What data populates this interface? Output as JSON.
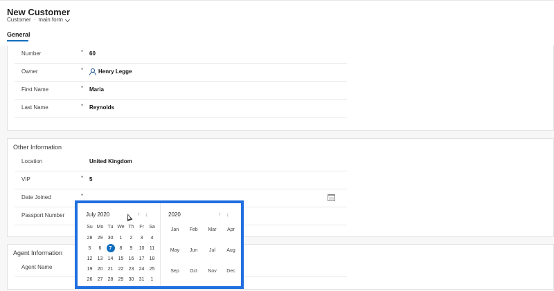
{
  "header": {
    "title": "New Customer",
    "entity": "Customer",
    "separator": "·",
    "form": "main form",
    "tab": "General"
  },
  "general": {
    "rows": [
      {
        "label": "Number",
        "required": "*",
        "value": "60"
      },
      {
        "label": "Owner",
        "required": "*",
        "value": "Henry Legge"
      },
      {
        "label": "First Name",
        "required": "*",
        "value": "Maria"
      },
      {
        "label": "Last Name",
        "required": "*",
        "value": "Reynolds"
      }
    ]
  },
  "other": {
    "title": "Other Information",
    "rows": [
      {
        "label": "Location",
        "required": "",
        "value": "United Kingdom"
      },
      {
        "label": "VIP",
        "required": "*",
        "value": "5"
      },
      {
        "label": "Date Joined",
        "required": "*",
        "value": ""
      },
      {
        "label": "Passport Number",
        "required": "",
        "value": ""
      }
    ]
  },
  "agent": {
    "title": "Agent Information",
    "rows": [
      {
        "label": "Agent Name",
        "required": "",
        "value": ""
      }
    ]
  },
  "calendar": {
    "month_label": "July 2020",
    "year_label": "2020",
    "up_arrow": "↑",
    "down_arrow": "↓",
    "weekdays": [
      "Su",
      "Mo",
      "Tu",
      "We",
      "Th",
      "Fr",
      "Sa"
    ],
    "days": [
      "28",
      "29",
      "30",
      "1",
      "2",
      "3",
      "4",
      "5",
      "6",
      "7",
      "8",
      "9",
      "10",
      "11",
      "12",
      "13",
      "14",
      "15",
      "16",
      "17",
      "18",
      "19",
      "20",
      "21",
      "22",
      "23",
      "24",
      "25",
      "26",
      "27",
      "28",
      "29",
      "30",
      "31",
      "1"
    ],
    "selected_index": 9,
    "months": [
      "Jan",
      "Feb",
      "Mar",
      "Apr",
      "May",
      "Jun",
      "Jul",
      "Aug",
      "Sep",
      "Oct",
      "Nov",
      "Dec"
    ]
  },
  "colors": {
    "accent": "#0f6cbd",
    "highlight_border": "#1f6fe0"
  },
  "icons": {
    "owner": "person-icon",
    "calendar": "calendar-icon",
    "form_switcher": "chevron-down-icon"
  }
}
